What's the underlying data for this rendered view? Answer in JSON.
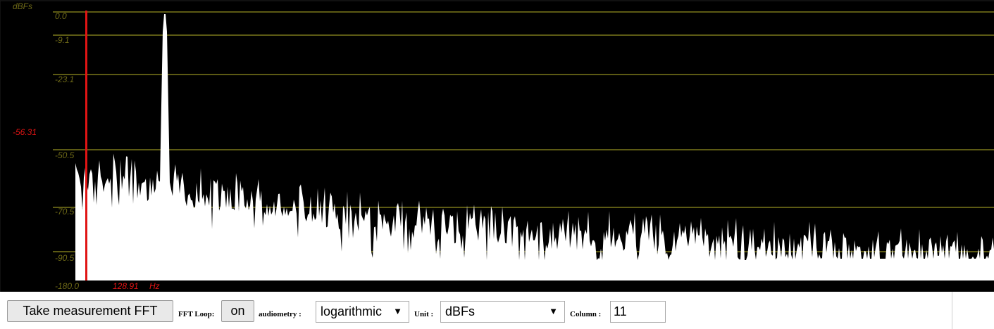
{
  "scope": {
    "unit_label": "dBFs",
    "y_ticks": [
      "0.0",
      "-9.1",
      "-23.1",
      "-50.5",
      "-70.5",
      "-90.5",
      "-180.0"
    ],
    "cursor_value": "-56.31",
    "cursor_freq": "128.91",
    "cursor_freq_unit": "Hz",
    "colors": {
      "background": "#000000",
      "grid": "#5c5a14",
      "tick": "#6f6a17",
      "cursor": "#e01414",
      "spectrum": "#ffffff"
    }
  },
  "controls": {
    "measure_button": "Take measurement FFT",
    "fft_loop_label": "FFT Loop:",
    "fft_loop_button": "on",
    "audiometry_label": "audiometry :",
    "audiometry_value": "logarithmic",
    "unit_label": "Unit :",
    "unit_value": "dBFs",
    "column_label": "Column :",
    "column_value": "11"
  }
}
